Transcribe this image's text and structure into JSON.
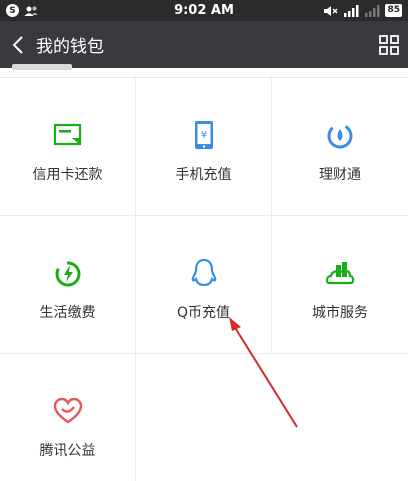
{
  "status_bar": {
    "time": "9:02 AM",
    "notif_badge": "S",
    "battery": "85"
  },
  "header": {
    "title": "我的钱包"
  },
  "grid": [
    {
      "label": "信用卡还款",
      "icon": "credit-card-icon",
      "color": "#1aad19"
    },
    {
      "label": "手机充值",
      "icon": "phone-yen-icon",
      "color": "#3a8ee6"
    },
    {
      "label": "理财通",
      "icon": "wealth-drop-icon",
      "color": "#3a8ee6"
    },
    {
      "label": "生活缴费",
      "icon": "bolt-circle-icon",
      "color": "#1aad19"
    },
    {
      "label": "Q币充值",
      "icon": "qq-penguin-icon",
      "color": "#3a8ee6"
    },
    {
      "label": "城市服务",
      "icon": "city-icon",
      "color": "#1aad19"
    },
    {
      "label": "腾讯公益",
      "icon": "charity-heart-icon",
      "color": "#e25b5b"
    }
  ],
  "annotation": {
    "arrow_color": "#d62b2b"
  }
}
